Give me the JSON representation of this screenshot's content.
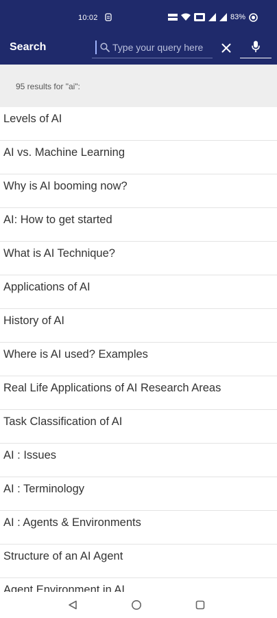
{
  "status_bar": {
    "time": "10:02",
    "battery": "83%"
  },
  "app_bar": {
    "title": "Search",
    "search": {
      "placeholder": "Type your query here",
      "value": ""
    }
  },
  "results": {
    "count_text": "95 results for \"ai\":",
    "items": [
      "Levels of AI",
      "AI vs. Machine Learning",
      "Why is AI booming now?",
      "AI: How to get started",
      "What is AI Technique?",
      "Applications of AI",
      "History of AI",
      "Where is AI used? Examples",
      "Real Life Applications of AI Research Areas",
      "Task Classification of AI",
      "AI : Issues",
      "AI : Terminology",
      "AI : Agents & Environments",
      "Structure of an AI Agent",
      "Agent Environment in AI"
    ]
  },
  "colors": {
    "app_bar": "#1f2a6b",
    "results_header": "#eeeeee",
    "divider": "#e3e3e3"
  },
  "icons": {
    "status_left": "shield-icon",
    "status_right": [
      "volte-icon",
      "wifi-icon",
      "lte-icon",
      "signal-icon",
      "signal-icon",
      "battery-icon"
    ],
    "search": "search-icon",
    "clear": "close-icon",
    "mic": "mic-icon",
    "nav": [
      "back-icon",
      "home-icon",
      "recents-icon"
    ]
  }
}
